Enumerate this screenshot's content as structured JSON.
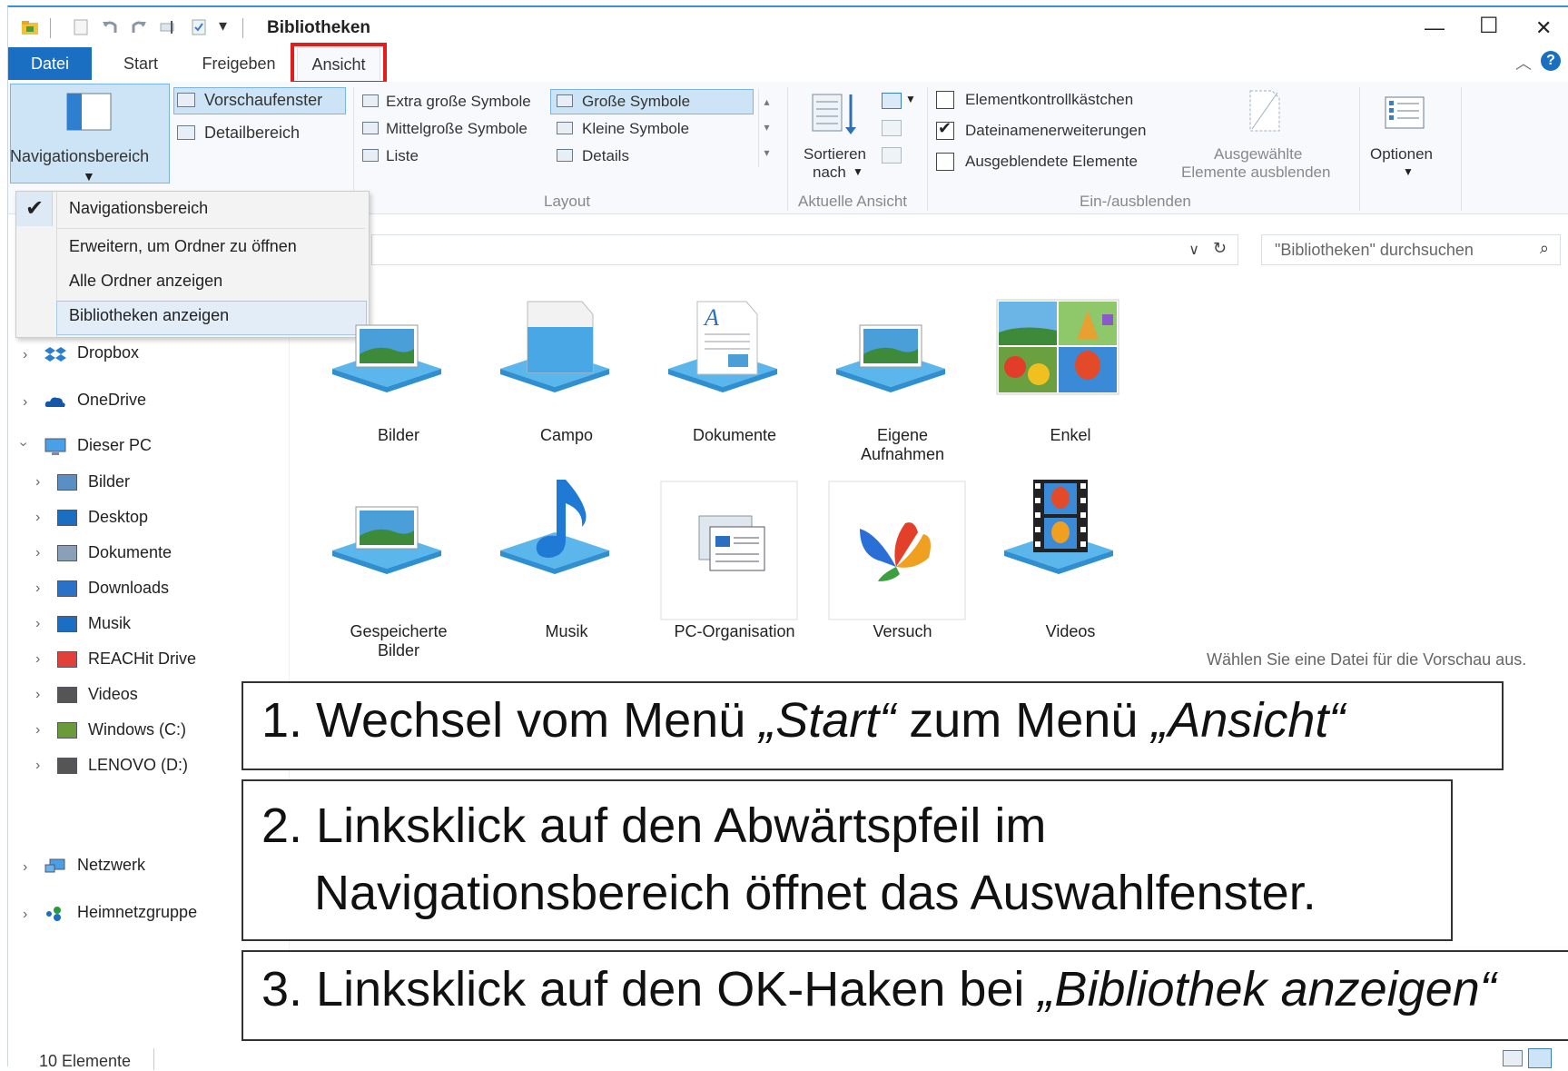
{
  "window": {
    "title": "Bibliotheken",
    "minimize_glyph": "—",
    "maximize_glyph": "☐",
    "close_glyph": "✕"
  },
  "menu": {
    "tabs": [
      "Datei",
      "Start",
      "Freigeben",
      "Ansicht"
    ],
    "highlighted_tab": "Ansicht",
    "highlight_color": "#e31c1c"
  },
  "ribbon": {
    "panes": {
      "navigation_pane": "Navigationsbereich",
      "preview_pane": "Vorschaufenster",
      "details_pane": "Detailbereich"
    },
    "layout": {
      "items": [
        "Extra große Symbole",
        "Große Symbole",
        "Mittelgroße Symbole",
        "Kleine Symbole",
        "Liste",
        "Details"
      ],
      "selected": "Große Symbole",
      "group_label": "Layout"
    },
    "current_view": {
      "sort_label": "Sortieren",
      "sort_label2": "nach",
      "group_label": "Aktuelle Ansicht"
    },
    "show_hide": {
      "checkboxes": [
        {
          "label": "Elementkontrollkästchen",
          "checked": false
        },
        {
          "label": "Dateinamenerweiterungen",
          "checked": true
        },
        {
          "label": "Ausgeblendete Elemente",
          "checked": false
        }
      ],
      "hide_selected_1": "Ausgewählte",
      "hide_selected_2": "Elemente ausblenden",
      "group_label": "Ein-/ausblenden"
    },
    "options_label": "Optionen"
  },
  "dropdown": {
    "items": [
      {
        "label": "Navigationsbereich",
        "checked": true
      },
      {
        "label": "Erweitern, um Ordner zu öffnen",
        "checked": false
      },
      {
        "label": "Alle Ordner anzeigen",
        "checked": false
      },
      {
        "label": "Bibliotheken anzeigen",
        "checked": false
      }
    ],
    "highlighted": "Bibliotheken anzeigen"
  },
  "search": {
    "placeholder": "\"Bibliotheken\" durchsuchen"
  },
  "nav": {
    "top_items": [
      "Dropbox",
      "OneDrive",
      "Dieser PC"
    ],
    "pc_children": [
      "Bilder",
      "Desktop",
      "Dokumente",
      "Downloads",
      "Musik",
      "REACHit Drive",
      "Videos",
      "Windows (C:)",
      "LENOVO (D:)"
    ],
    "bottom_items": [
      "Netzwerk",
      "Heimnetzgruppe"
    ]
  },
  "libraries": [
    {
      "name": "Bilder",
      "icon": "pictures-library-icon"
    },
    {
      "name": "Campo",
      "icon": "blank-library-icon"
    },
    {
      "name": "Dokumente",
      "icon": "documents-library-icon"
    },
    {
      "name": "Eigene Aufnahmen",
      "icon": "pictures-library-icon"
    },
    {
      "name": "Enkel",
      "icon": "photo-collage-icon"
    },
    {
      "name": "Gespeicherte Bilder",
      "icon": "pictures-library-icon"
    },
    {
      "name": "Musik",
      "icon": "music-library-icon"
    },
    {
      "name": "PC-Organisation",
      "icon": "pc-organisation-icon"
    },
    {
      "name": "Versuch",
      "icon": "butterfly-icon"
    },
    {
      "name": "Videos",
      "icon": "videos-library-icon"
    }
  ],
  "preview_message": "Wählen Sie eine Datei für die Vorschau aus.",
  "status": {
    "count": "10 Elemente"
  },
  "annotations": {
    "step1_prefix": "1. Wechsel vom Menü ",
    "step1_italic1": "„Start“",
    "step1_mid": " zum Menü ",
    "step1_italic2": "„Ansicht“",
    "step2_line1": "2. Linksklick auf den Abwärtspfeil im",
    "step2_line2": "Navigationsbereich öffnet das Auswahlfenster.",
    "step3_prefix": "3. Linksklick auf den OK-Haken bei ",
    "step3_italic": "„Bibliothek anzeigen“"
  }
}
